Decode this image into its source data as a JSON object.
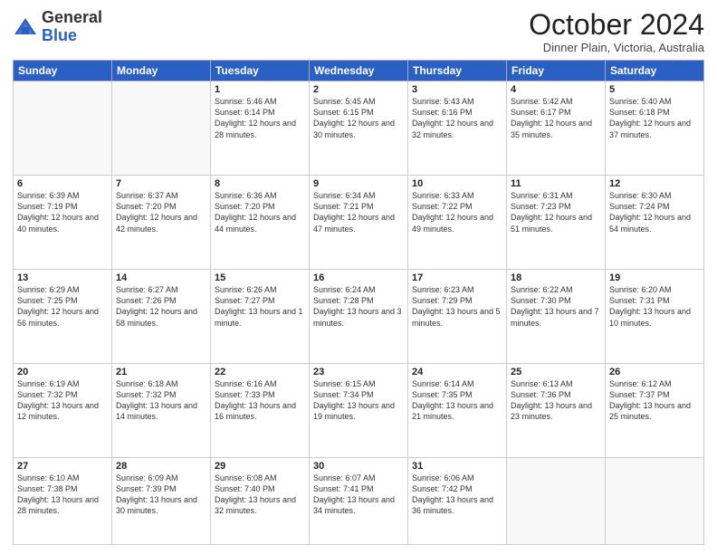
{
  "header": {
    "logo_general": "General",
    "logo_blue": "Blue",
    "month_title": "October 2024",
    "location": "Dinner Plain, Victoria, Australia"
  },
  "days_of_week": [
    "Sunday",
    "Monday",
    "Tuesday",
    "Wednesday",
    "Thursday",
    "Friday",
    "Saturday"
  ],
  "weeks": [
    [
      {
        "day": "",
        "info": ""
      },
      {
        "day": "",
        "info": ""
      },
      {
        "day": "1",
        "info": "Sunrise: 5:46 AM\nSunset: 6:14 PM\nDaylight: 12 hours and 28 minutes."
      },
      {
        "day": "2",
        "info": "Sunrise: 5:45 AM\nSunset: 6:15 PM\nDaylight: 12 hours and 30 minutes."
      },
      {
        "day": "3",
        "info": "Sunrise: 5:43 AM\nSunset: 6:16 PM\nDaylight: 12 hours and 32 minutes."
      },
      {
        "day": "4",
        "info": "Sunrise: 5:42 AM\nSunset: 6:17 PM\nDaylight: 12 hours and 35 minutes."
      },
      {
        "day": "5",
        "info": "Sunrise: 5:40 AM\nSunset: 6:18 PM\nDaylight: 12 hours and 37 minutes."
      }
    ],
    [
      {
        "day": "6",
        "info": "Sunrise: 6:39 AM\nSunset: 7:19 PM\nDaylight: 12 hours and 40 minutes."
      },
      {
        "day": "7",
        "info": "Sunrise: 6:37 AM\nSunset: 7:20 PM\nDaylight: 12 hours and 42 minutes."
      },
      {
        "day": "8",
        "info": "Sunrise: 6:36 AM\nSunset: 7:20 PM\nDaylight: 12 hours and 44 minutes."
      },
      {
        "day": "9",
        "info": "Sunrise: 6:34 AM\nSunset: 7:21 PM\nDaylight: 12 hours and 47 minutes."
      },
      {
        "day": "10",
        "info": "Sunrise: 6:33 AM\nSunset: 7:22 PM\nDaylight: 12 hours and 49 minutes."
      },
      {
        "day": "11",
        "info": "Sunrise: 6:31 AM\nSunset: 7:23 PM\nDaylight: 12 hours and 51 minutes."
      },
      {
        "day": "12",
        "info": "Sunrise: 6:30 AM\nSunset: 7:24 PM\nDaylight: 12 hours and 54 minutes."
      }
    ],
    [
      {
        "day": "13",
        "info": "Sunrise: 6:29 AM\nSunset: 7:25 PM\nDaylight: 12 hours and 56 minutes."
      },
      {
        "day": "14",
        "info": "Sunrise: 6:27 AM\nSunset: 7:26 PM\nDaylight: 12 hours and 58 minutes."
      },
      {
        "day": "15",
        "info": "Sunrise: 6:26 AM\nSunset: 7:27 PM\nDaylight: 13 hours and 1 minute."
      },
      {
        "day": "16",
        "info": "Sunrise: 6:24 AM\nSunset: 7:28 PM\nDaylight: 13 hours and 3 minutes."
      },
      {
        "day": "17",
        "info": "Sunrise: 6:23 AM\nSunset: 7:29 PM\nDaylight: 13 hours and 5 minutes."
      },
      {
        "day": "18",
        "info": "Sunrise: 6:22 AM\nSunset: 7:30 PM\nDaylight: 13 hours and 7 minutes."
      },
      {
        "day": "19",
        "info": "Sunrise: 6:20 AM\nSunset: 7:31 PM\nDaylight: 13 hours and 10 minutes."
      }
    ],
    [
      {
        "day": "20",
        "info": "Sunrise: 6:19 AM\nSunset: 7:32 PM\nDaylight: 13 hours and 12 minutes."
      },
      {
        "day": "21",
        "info": "Sunrise: 6:18 AM\nSunset: 7:32 PM\nDaylight: 13 hours and 14 minutes."
      },
      {
        "day": "22",
        "info": "Sunrise: 6:16 AM\nSunset: 7:33 PM\nDaylight: 13 hours and 16 minutes."
      },
      {
        "day": "23",
        "info": "Sunrise: 6:15 AM\nSunset: 7:34 PM\nDaylight: 13 hours and 19 minutes."
      },
      {
        "day": "24",
        "info": "Sunrise: 6:14 AM\nSunset: 7:35 PM\nDaylight: 13 hours and 21 minutes."
      },
      {
        "day": "25",
        "info": "Sunrise: 6:13 AM\nSunset: 7:36 PM\nDaylight: 13 hours and 23 minutes."
      },
      {
        "day": "26",
        "info": "Sunrise: 6:12 AM\nSunset: 7:37 PM\nDaylight: 13 hours and 25 minutes."
      }
    ],
    [
      {
        "day": "27",
        "info": "Sunrise: 6:10 AM\nSunset: 7:38 PM\nDaylight: 13 hours and 28 minutes."
      },
      {
        "day": "28",
        "info": "Sunrise: 6:09 AM\nSunset: 7:39 PM\nDaylight: 13 hours and 30 minutes."
      },
      {
        "day": "29",
        "info": "Sunrise: 6:08 AM\nSunset: 7:40 PM\nDaylight: 13 hours and 32 minutes."
      },
      {
        "day": "30",
        "info": "Sunrise: 6:07 AM\nSunset: 7:41 PM\nDaylight: 13 hours and 34 minutes."
      },
      {
        "day": "31",
        "info": "Sunrise: 6:06 AM\nSunset: 7:42 PM\nDaylight: 13 hours and 36 minutes."
      },
      {
        "day": "",
        "info": ""
      },
      {
        "day": "",
        "info": ""
      }
    ]
  ]
}
